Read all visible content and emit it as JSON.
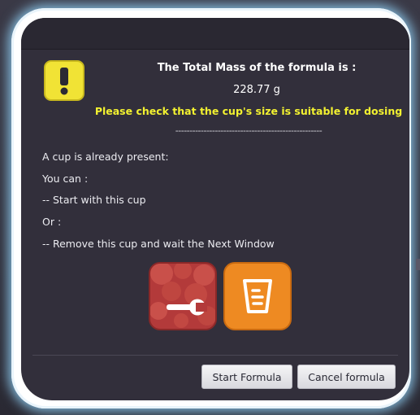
{
  "dialog": {
    "title_line": "The Total Mass of the formula is :",
    "mass_value": "228.77 g",
    "warning": "Please check that the cup's size is suitable for dosing",
    "separator": "----------------------------------------------------",
    "messages": [
      "A cup is already present:",
      "You can :",
      "-- Start with this cup",
      "Or :",
      "-- Remove this cup and wait the Next Window"
    ],
    "buttons": {
      "start": "Start Formula",
      "cancel": "Cancel formula"
    }
  },
  "icons": {
    "warning": "warning-icon",
    "remove_cup": "wrench-icon",
    "start_cup": "cup-icon"
  },
  "colors": {
    "dialog_bg": "#322f3b",
    "warning_text": "#f3f230",
    "warning_badge": "#f1e335",
    "remove_button": "#b33a3a",
    "start_button": "#ee8a22"
  }
}
